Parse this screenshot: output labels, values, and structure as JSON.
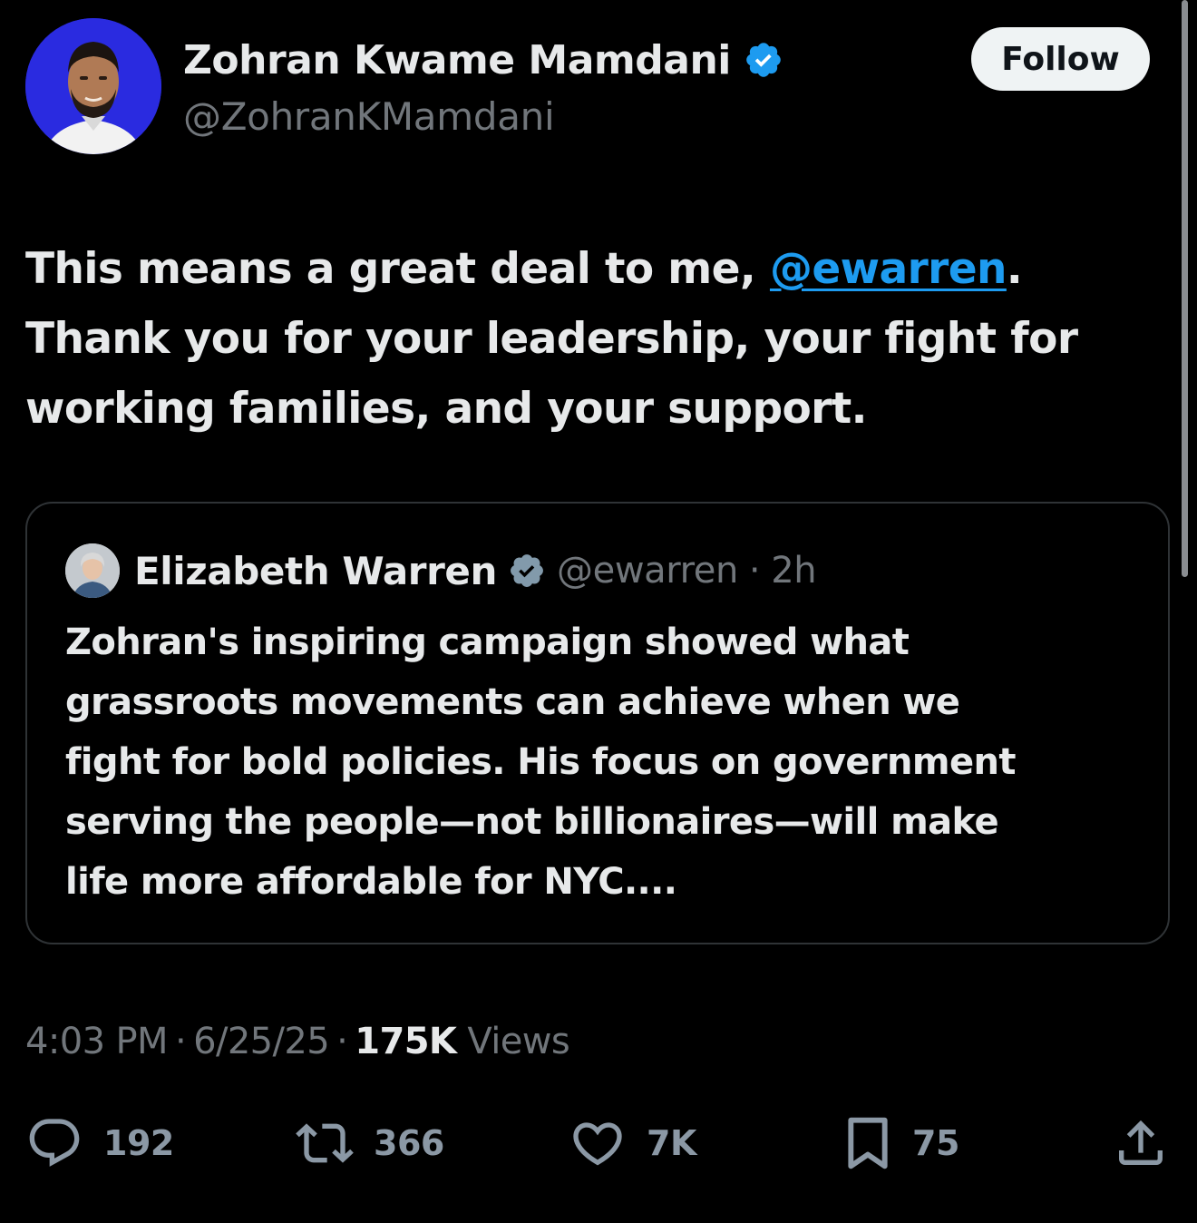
{
  "author": {
    "display_name": "Zohran Kwame Mamdani",
    "handle": "@ZohranKMamdani",
    "verified": true,
    "avatar_bg": "#2a2be0"
  },
  "follow_label": "Follow",
  "tweet": {
    "line1_before": "This means a great deal to me, ",
    "mention": "@ewarren",
    "line1_after": ".",
    "line2": "Thank you for your leadership, your fight for",
    "line3": "working families, and your support."
  },
  "quote": {
    "name": "Elizabeth Warren",
    "handle": "@ewarren",
    "dot": "·",
    "time": "2h",
    "lines": [
      "Zohran's inspiring campaign showed what",
      "grassroots movements can achieve when we",
      "fight for bold policies. His focus on government",
      "serving the people—not billionaires—will make",
      "life more affordable for NYC...."
    ]
  },
  "meta": {
    "time": "4:03 PM",
    "sep": "·",
    "date": "6/25/25",
    "views_count": "175K",
    "views_label": "Views"
  },
  "actions": {
    "replies": "192",
    "reposts": "366",
    "likes": "7K",
    "bookmarks": "75"
  },
  "icons": {
    "reply": "reply-icon",
    "retweet": "retweet-icon",
    "like": "heart-icon",
    "bookmark": "bookmark-icon",
    "share": "share-icon",
    "verified": "verified-badge-icon"
  },
  "colors": {
    "background": "#000000",
    "text": "#e7e9ea",
    "muted": "#71767b",
    "link": "#1d9bf0",
    "verified_blue": "#1d9bf0",
    "verified_gray": "#829aab",
    "border": "#2f3336"
  }
}
